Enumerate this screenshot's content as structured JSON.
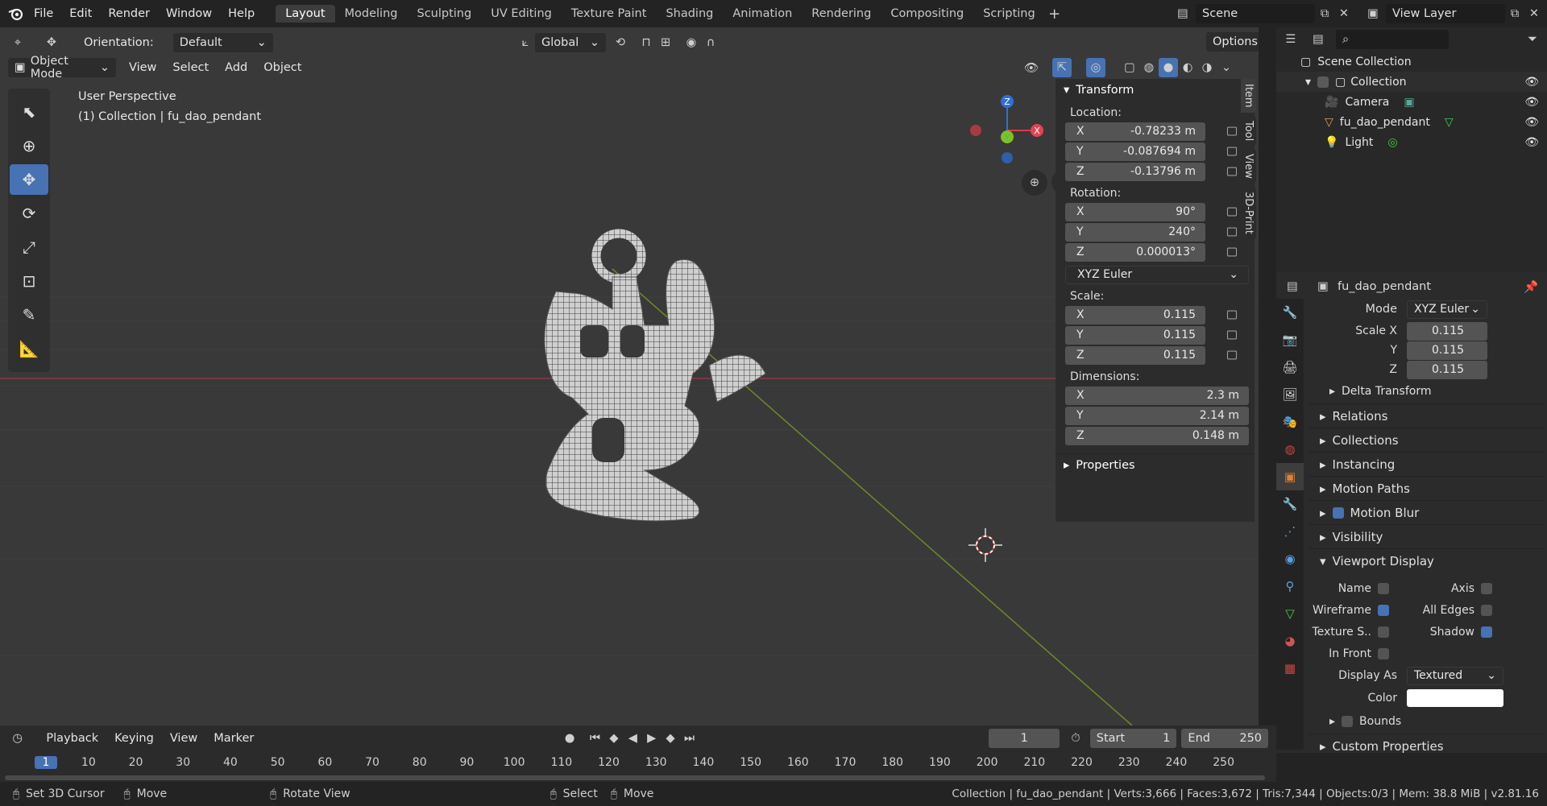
{
  "app": {
    "logo": "blender-icon"
  },
  "menu": [
    "File",
    "Edit",
    "Render",
    "Window",
    "Help"
  ],
  "workspaces": [
    "Layout",
    "Modeling",
    "Sculpting",
    "UV Editing",
    "Texture Paint",
    "Shading",
    "Animation",
    "Rendering",
    "Compositing",
    "Scripting"
  ],
  "scene": {
    "name": "Scene",
    "view_layer": "View Layer"
  },
  "viewport": {
    "orientation_label": "Orientation:",
    "orientation_value": "Default",
    "transform_space": "Global",
    "options_label": "Options",
    "mode": "Object Mode",
    "header_menu": [
      "View",
      "Select",
      "Add",
      "Object"
    ],
    "overlay_line1": "User Perspective",
    "overlay_line2": "(1) Collection | fu_dao_pendant",
    "gizmo": {
      "x": "X",
      "y": "Y",
      "z": "Z"
    }
  },
  "npanel": {
    "transform_title": "Transform",
    "location_label": "Location:",
    "location": [
      {
        "axis": "X",
        "value": "-0.78233 m"
      },
      {
        "axis": "Y",
        "value": "-0.087694 m"
      },
      {
        "axis": "Z",
        "value": "-0.13796 m"
      }
    ],
    "rotation_label": "Rotation:",
    "rotation": [
      {
        "axis": "X",
        "value": "90°"
      },
      {
        "axis": "Y",
        "value": "240°"
      },
      {
        "axis": "Z",
        "value": "0.000013°"
      }
    ],
    "rotation_mode": "XYZ Euler",
    "scale_label": "Scale:",
    "scale": [
      {
        "axis": "X",
        "value": "0.115"
      },
      {
        "axis": "Y",
        "value": "0.115"
      },
      {
        "axis": "Z",
        "value": "0.115"
      }
    ],
    "dimensions_label": "Dimensions:",
    "dimensions": [
      {
        "axis": "X",
        "value": "2.3 m"
      },
      {
        "axis": "Y",
        "value": "2.14 m"
      },
      {
        "axis": "Z",
        "value": "0.148 m"
      }
    ],
    "properties_title": "Properties",
    "tabs": [
      "Item",
      "Tool",
      "View",
      "3D-Print"
    ]
  },
  "outliner": {
    "root": "Scene Collection",
    "collection": "Collection",
    "items": [
      "Camera",
      "fu_dao_pendant",
      "Light"
    ]
  },
  "properties": {
    "object_name": "fu_dao_pendant",
    "mode_label": "Mode",
    "mode_value": "XYZ Euler",
    "scale_x_label": "Scale X",
    "y_label": "Y",
    "z_label": "Z",
    "scale_x": "0.115",
    "scale_y": "0.115",
    "scale_z": "0.115",
    "delta": "Delta Transform",
    "sections": [
      "Relations",
      "Collections",
      "Instancing",
      "Motion Paths",
      "Motion Blur",
      "Visibility"
    ],
    "viewport_display": "Viewport Display",
    "vd": {
      "name": "Name",
      "axis": "Axis",
      "wireframe": "Wireframe",
      "all_edges": "All Edges",
      "texture_space": "Texture S..",
      "shadow": "Shadow",
      "in_front": "In Front",
      "display_as_label": "Display As",
      "display_as": "Textured",
      "color_label": "Color"
    },
    "bounds": "Bounds",
    "custom": "Custom Properties"
  },
  "timeline": {
    "menus": [
      "Playback",
      "Keying",
      "View",
      "Marker"
    ],
    "current_frame": "1",
    "start_label": "Start",
    "start": "1",
    "end_label": "End",
    "end": "250",
    "ticks": [
      "1",
      "10",
      "20",
      "30",
      "40",
      "50",
      "60",
      "70",
      "80",
      "90",
      "100",
      "110",
      "120",
      "130",
      "140",
      "150",
      "160",
      "170",
      "180",
      "190",
      "200",
      "210",
      "220",
      "230",
      "240",
      "250"
    ]
  },
  "status": {
    "hints": [
      "Set 3D Cursor",
      "Move",
      "Rotate View",
      "Select",
      "Move"
    ],
    "info": "Collection | fu_dao_pendant | Verts:3,666 | Faces:3,672 | Tris:7,344 | Objects:0/3 | Mem: 38.8 MiB | v2.81.16"
  }
}
